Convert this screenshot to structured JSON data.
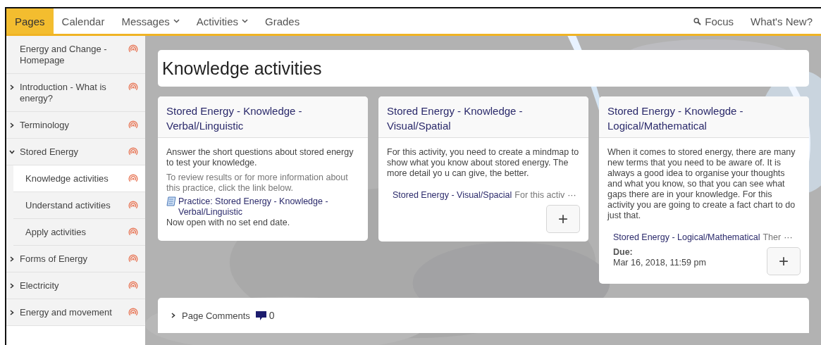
{
  "nav": {
    "tabs": [
      {
        "label": "Pages",
        "selected": true,
        "dropdown": false
      },
      {
        "label": "Calendar",
        "selected": false,
        "dropdown": false
      },
      {
        "label": "Messages",
        "selected": false,
        "dropdown": true
      },
      {
        "label": "Activities",
        "selected": false,
        "dropdown": true
      },
      {
        "label": "Grades",
        "selected": false,
        "dropdown": false
      }
    ],
    "focus": "Focus",
    "whats_new": "What's New?"
  },
  "sidebar": {
    "items": [
      {
        "label": "Energy and Change - Homepage",
        "kind": "page",
        "selected": false
      },
      {
        "label": "Introduction - What is energy?",
        "kind": "folder",
        "expanded": false,
        "selected": false
      },
      {
        "label": "Terminology",
        "kind": "folder",
        "expanded": false,
        "selected": false
      },
      {
        "label": "Stored Energy",
        "kind": "folder",
        "expanded": true,
        "selected": false,
        "children": [
          {
            "label": "Knowledge activities",
            "selected": true
          },
          {
            "label": "Understand activities",
            "selected": false
          },
          {
            "label": "Apply activities",
            "selected": false
          }
        ]
      },
      {
        "label": "Forms of Energy",
        "kind": "folder",
        "expanded": false,
        "selected": false
      },
      {
        "label": "Electricity",
        "kind": "folder",
        "expanded": false,
        "selected": false
      },
      {
        "label": "Energy and movement",
        "kind": "folder",
        "expanded": false,
        "selected": false
      }
    ]
  },
  "page_title": "Knowledge activities",
  "cards": [
    {
      "title": "Stored Energy - Knowledge - Verbal/Linguistic",
      "body": "Answer the short questions about stored energy to test your knowledge.",
      "kind": "practice",
      "note": "To review results or for more information about this practice, click the link below.",
      "link": "Practice: Stored Energy - Knowledge - Verbal/Linguistic",
      "status": "Now open with no set end date."
    },
    {
      "title": "Stored Energy - Knowledge - Visual/Spatial",
      "body": "For this activity, you need to create a mindmap to show what you know about stored energy. The more detail yo u can give, the better.",
      "kind": "submission",
      "item_title": "Stored Energy - Visual/Spacial",
      "item_preview": "For this activ",
      "more": "···",
      "add": "+"
    },
    {
      "title": "Stored Energy - Knowlegde - Logical/Mathematical",
      "body": "When it comes to stored energy, there are many new terms that you need to be aware of. It is always a good idea to organise your thoughts and what you know, so that you can see what gaps there are in your knowledge. For this activity you are going to create a fact chart to do just that.",
      "kind": "submission",
      "item_title": "Stored Energy - Logical/Mathematical",
      "item_preview": "Ther",
      "more": "···",
      "due_label": "Due:",
      "due": "Mar 16, 2018, 11:59 pm",
      "add": "+"
    }
  ],
  "comments": {
    "label": "Page Comments",
    "count": "0"
  }
}
